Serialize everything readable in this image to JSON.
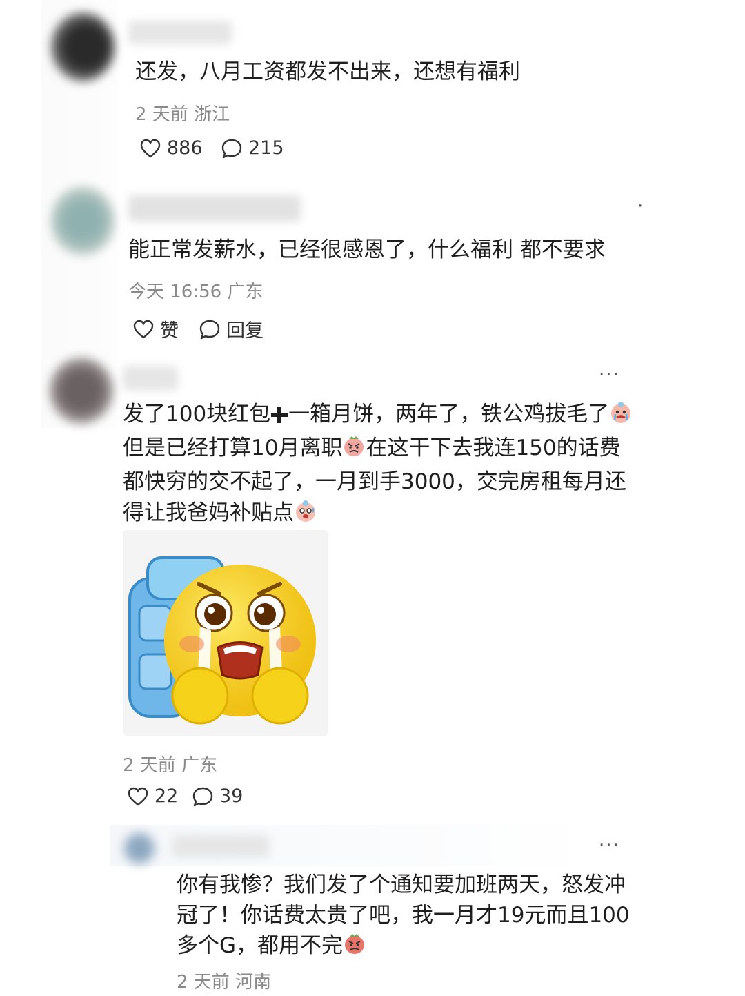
{
  "comments": [
    {
      "text": "还发，八月工资都发不出来，还想有福利",
      "meta": "2 天前 浙江",
      "likes": "886",
      "replies": "215"
    },
    {
      "text": "能正常发薪水，已经很感恩了，什么福利 都不要求",
      "meta": "今天 16:56 广东",
      "likes": "赞",
      "replies": "回复",
      "menu": "·"
    },
    {
      "lines": [
        "发了100块红包",
        "一箱月饼，两年了，铁公鸡拔毛了",
        "但是已经打算10月离职",
        "在这干下去我连150的话费",
        "都快穷的交不起了，一月到手3000，交完房租每月还",
        "得让我爸妈补贴点"
      ],
      "meta": "2 天前 广东",
      "likes": "22",
      "replies": "39",
      "menu": "···"
    },
    {
      "lines": [
        "你有我惨？我们发了个通知要加班两天，怒发冲",
        "冠了！你话费太贵了吧，我一月才19元而且100",
        "多个G，都用不完"
      ],
      "meta": "2 天前 河南",
      "menu": "···"
    }
  ],
  "icons": {
    "like": "heart-outline-icon",
    "reply": "speech-bubble-icon",
    "plus": "heavy-plus-icon",
    "crying": "crying-face-emoji",
    "angry": "angry-face-emoji",
    "sweat": "sweat-face-emoji",
    "sticker": "crying-emoji-with-backpack-sticker"
  },
  "colors": {
    "text": "#1e1e1e",
    "meta": "#8a8a8a",
    "emoji_yellow": "#f7d21a",
    "emoji_pink": "#f4a7a0"
  }
}
